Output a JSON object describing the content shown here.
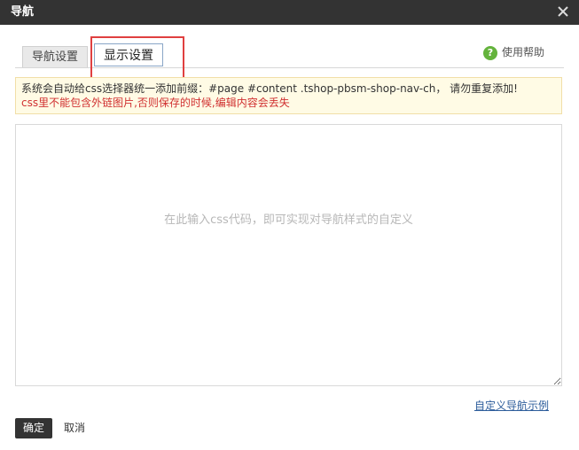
{
  "window": {
    "title": "导航",
    "close_icon": "close-icon"
  },
  "tabs": [
    {
      "label": "导航设置",
      "active": false
    },
    {
      "label": "显示设置",
      "active": true
    }
  ],
  "help": {
    "label": "使用帮助",
    "icon": "help-icon",
    "icon_color": "#64b33c"
  },
  "notice": {
    "line1": "系统会自动给css选择器统一添加前缀：#page #content .tshop-pbsm-shop-nav-ch， 请勿重复添加!",
    "line2": "css里不能包含外链图片,否则保存的时候,编辑内容会丢失"
  },
  "editor": {
    "placeholder": "在此输入css代码，即可实现对导航样式的自定义",
    "value": ""
  },
  "example_link": "自定义导航示例",
  "buttons": {
    "ok": "确定",
    "cancel": "取消"
  },
  "colors": {
    "titlebar": "#333333",
    "highlight": "#e04040",
    "warning_text": "#d03030",
    "link": "#2d5d9b"
  }
}
